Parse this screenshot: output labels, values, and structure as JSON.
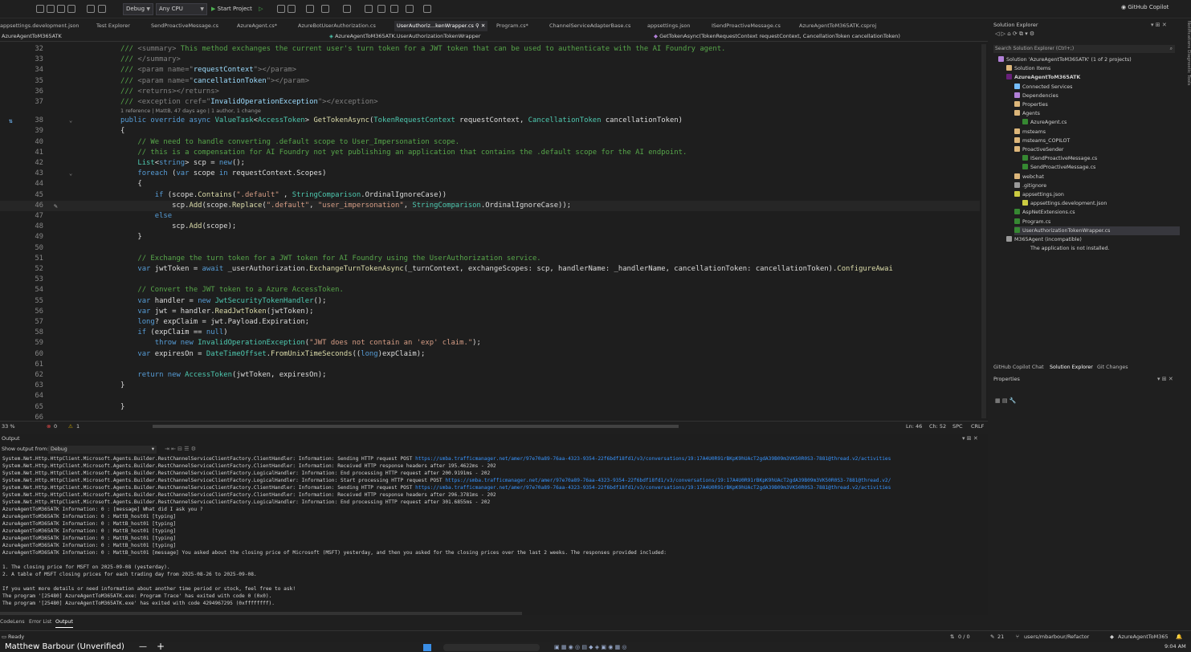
{
  "toolbar": {
    "config": "Debug",
    "platform": "Any CPU",
    "start": "Start Project",
    "copilot": "GitHub Copilot"
  },
  "tabs": [
    {
      "label": "appsettings.development.json",
      "active": false
    },
    {
      "label": "Test Explorer",
      "active": false
    },
    {
      "label": "SendProactiveMessage.cs",
      "active": false
    },
    {
      "label": "AzureAgent.cs*",
      "active": false
    },
    {
      "label": "AzureBotUserAuthorization.cs",
      "active": false
    },
    {
      "label": "UserAuthoriz...kenWrapper.cs",
      "active": true
    },
    {
      "label": "Program.cs*",
      "active": false
    },
    {
      "label": "ChannelServiceAdapterBase.cs",
      "active": false
    },
    {
      "label": "appsettings.json",
      "active": false
    },
    {
      "label": "ISendProactiveMessage.cs",
      "active": false
    },
    {
      "label": "AzureAgentToM365ATK.csproj",
      "active": false
    }
  ],
  "nav": {
    "project": "AzureAgentToM365ATK",
    "type": "AzureAgentToM365ATK.UserAuthorizationTokenWrapper",
    "member": "GetTokenAsync(TokenRequestContext requestContext, CancellationToken cancellationToken)"
  },
  "code": [
    {
      "n": "32",
      "t": [
        [
          "/// ",
          "cm"
        ],
        [
          "<summary>",
          "xm"
        ],
        [
          " This method exchanges the current user's turn token for a JWT token that can be used to authenticate with the AI Foundry agent.",
          "cm"
        ]
      ]
    },
    {
      "n": "33",
      "t": [
        [
          "/// ",
          "cm"
        ],
        [
          "</summary>",
          "xm"
        ]
      ]
    },
    {
      "n": "34",
      "t": [
        [
          "/// ",
          "cm"
        ],
        [
          "<param name=\"",
          "xm"
        ],
        [
          "requestContext",
          "pm"
        ],
        [
          "\"></param>",
          "xm"
        ]
      ]
    },
    {
      "n": "35",
      "t": [
        [
          "/// ",
          "cm"
        ],
        [
          "<param name=\"",
          "xm"
        ],
        [
          "cancellationToken",
          "pm"
        ],
        [
          "\"></param>",
          "xm"
        ]
      ]
    },
    {
      "n": "36",
      "t": [
        [
          "/// ",
          "cm"
        ],
        [
          "<returns></returns>",
          "xm"
        ]
      ]
    },
    {
      "n": "37",
      "t": [
        [
          "/// ",
          "cm"
        ],
        [
          "<exception cref=\"",
          "xm"
        ],
        [
          "InvalidOperationException",
          "pm"
        ],
        [
          "\"></exception>",
          "xm"
        ]
      ],
      "lens": "1 reference | MattB, 47 days ago | 1 author, 1 change"
    },
    {
      "n": "38",
      "t": [
        [
          "public override async ",
          "kw"
        ],
        [
          "ValueTask",
          "ty"
        ],
        [
          "<",
          ""
        ],
        [
          "AccessToken",
          "ty"
        ],
        [
          "> ",
          ""
        ],
        [
          "GetTokenAsync",
          "mt"
        ],
        [
          "(",
          ""
        ],
        [
          "TokenRequestContext",
          "ty"
        ],
        [
          " requestContext, ",
          ""
        ],
        [
          "CancellationToken",
          "ty"
        ],
        [
          " cancellationToken)",
          ""
        ]
      ]
    },
    {
      "n": "39",
      "t": [
        [
          "{",
          ""
        ]
      ]
    },
    {
      "n": "40",
      "t": [
        [
          "    // We need to handle converting .default scope to User_Impersonation scope.",
          "cm"
        ]
      ]
    },
    {
      "n": "41",
      "t": [
        [
          "    // this is a compensation for AI Foundry not yet publishing an application that contains the .default scope for the AI endpoint.",
          "cm"
        ]
      ]
    },
    {
      "n": "42",
      "t": [
        [
          "    ",
          ""
        ],
        [
          "List",
          "ty"
        ],
        [
          "<",
          ""
        ],
        [
          "string",
          "kw"
        ],
        [
          "> scp = ",
          ""
        ],
        [
          "new",
          "kw"
        ],
        [
          "();",
          ""
        ]
      ]
    },
    {
      "n": "43",
      "t": [
        [
          "    ",
          ""
        ],
        [
          "foreach",
          "kw"
        ],
        [
          " (",
          ""
        ],
        [
          "var",
          "kw"
        ],
        [
          " scope ",
          ""
        ],
        [
          "in",
          "kw"
        ],
        [
          " requestContext.Scopes)",
          ""
        ]
      ]
    },
    {
      "n": "44",
      "t": [
        [
          "    {",
          ""
        ]
      ]
    },
    {
      "n": "45",
      "t": [
        [
          "        ",
          ""
        ],
        [
          "if",
          "kw"
        ],
        [
          " (scope.",
          ""
        ],
        [
          "Contains",
          "mt"
        ],
        [
          "(",
          ""
        ],
        [
          "\".default\"",
          "st"
        ],
        [
          " , ",
          ""
        ],
        [
          "StringComparison",
          "ty"
        ],
        [
          ".OrdinalIgnoreCase))",
          ""
        ]
      ]
    },
    {
      "n": "46",
      "t": [
        [
          "            scp.",
          ""
        ],
        [
          "Add",
          "mt"
        ],
        [
          "(scope.",
          ""
        ],
        [
          "Replace",
          "mt"
        ],
        [
          "(",
          ""
        ],
        [
          "\".default\"",
          "st"
        ],
        [
          ", ",
          ""
        ],
        [
          "\"user_impersonation\"",
          "st"
        ],
        [
          ", ",
          ""
        ],
        [
          "StringComparison",
          "ty"
        ],
        [
          ".OrdinalIgnoreCase));",
          ""
        ]
      ]
    },
    {
      "n": "47",
      "t": [
        [
          "        ",
          ""
        ],
        [
          "else",
          "kw"
        ]
      ]
    },
    {
      "n": "48",
      "t": [
        [
          "            scp.",
          ""
        ],
        [
          "Add",
          "mt"
        ],
        [
          "(scope);",
          ""
        ]
      ]
    },
    {
      "n": "49",
      "t": [
        [
          "    }",
          ""
        ]
      ]
    },
    {
      "n": "50",
      "t": [
        [
          "",
          ""
        ]
      ]
    },
    {
      "n": "51",
      "t": [
        [
          "    // Exchange the turn token for a JWT token for AI Foundry using the UserAuthorization service.",
          "cm"
        ]
      ]
    },
    {
      "n": "52",
      "t": [
        [
          "    ",
          ""
        ],
        [
          "var",
          "kw"
        ],
        [
          " jwtToken = ",
          ""
        ],
        [
          "await",
          "kw"
        ],
        [
          " _userAuthorization.",
          ""
        ],
        [
          "ExchangeTurnTokenAsync",
          "mt"
        ],
        [
          "(_turnContext, exchangeScopes: scp, handlerName: _handlerName, cancellationToken: cancellationToken).",
          ""
        ],
        [
          "ConfigureAwai",
          "mt"
        ]
      ]
    },
    {
      "n": "53",
      "t": [
        [
          "",
          ""
        ]
      ]
    },
    {
      "n": "54",
      "t": [
        [
          "    // Convert the JWT token to a Azure AccessToken.",
          "cm"
        ]
      ]
    },
    {
      "n": "55",
      "t": [
        [
          "    ",
          ""
        ],
        [
          "var",
          "kw"
        ],
        [
          " handler = ",
          ""
        ],
        [
          "new",
          "kw"
        ],
        [
          " ",
          ""
        ],
        [
          "JwtSecurityTokenHandler",
          "ty"
        ],
        [
          "();",
          ""
        ]
      ]
    },
    {
      "n": "56",
      "t": [
        [
          "    ",
          ""
        ],
        [
          "var",
          "kw"
        ],
        [
          " jwt = handler.",
          ""
        ],
        [
          "ReadJwtToken",
          "mt"
        ],
        [
          "(jwtToken);",
          ""
        ]
      ]
    },
    {
      "n": "57",
      "t": [
        [
          "    ",
          ""
        ],
        [
          "long",
          "kw"
        ],
        [
          "? expClaim = jwt.Payload.Expiration;",
          ""
        ]
      ]
    },
    {
      "n": "58",
      "t": [
        [
          "    ",
          ""
        ],
        [
          "if",
          "kw"
        ],
        [
          " (expClaim == ",
          ""
        ],
        [
          "null",
          "kw"
        ],
        [
          ")",
          ""
        ]
      ]
    },
    {
      "n": "59",
      "t": [
        [
          "        ",
          ""
        ],
        [
          "throw new ",
          "kw"
        ],
        [
          "InvalidOperationException",
          "ty"
        ],
        [
          "(",
          ""
        ],
        [
          "\"JWT does not contain an 'exp' claim.\"",
          "st"
        ],
        [
          ");",
          ""
        ]
      ]
    },
    {
      "n": "60",
      "t": [
        [
          "    ",
          ""
        ],
        [
          "var",
          "kw"
        ],
        [
          " expiresOn = ",
          ""
        ],
        [
          "DateTimeOffset",
          "ty"
        ],
        [
          ".",
          ""
        ],
        [
          "FromUnixTimeSeconds",
          "mt"
        ],
        [
          "((",
          ""
        ],
        [
          "long",
          "kw"
        ],
        [
          ")expClaim);",
          ""
        ]
      ]
    },
    {
      "n": "61",
      "t": [
        [
          "",
          ""
        ]
      ]
    },
    {
      "n": "62",
      "t": [
        [
          "    ",
          ""
        ],
        [
          "return new ",
          "kw"
        ],
        [
          "AccessToken",
          "ty"
        ],
        [
          "(jwtToken, expiresOn);",
          ""
        ]
      ]
    },
    {
      "n": "63",
      "t": [
        [
          "}",
          ""
        ]
      ]
    },
    {
      "n": "64",
      "t": [
        [
          "",
          ""
        ]
      ]
    },
    {
      "n": "65",
      "t": [
        [
          "}",
          ""
        ]
      ]
    },
    {
      "n": "66",
      "t": [
        [
          "",
          ""
        ]
      ]
    }
  ],
  "editor_status": {
    "zoom": "33 %",
    "errors": "0",
    "warnings": "1",
    "ln": "Ln: 46",
    "ch": "Ch: 52",
    "spc": "SPC",
    "crlf": "CRLF"
  },
  "solution": {
    "title": "Solution Explorer",
    "search": "Search Solution Explorer (Ctrl+;)",
    "items": [
      {
        "label": "Solution 'AzureAgentToM365ATK' (1 of 2 projects)",
        "indent": 0,
        "color": "#b180d7"
      },
      {
        "label": "Solution Items",
        "indent": 1,
        "color": "#dcb67a"
      },
      {
        "label": "AzureAgentToM365ATK",
        "indent": 1,
        "color": "#68217a",
        "bold": true
      },
      {
        "label": "Connected Services",
        "indent": 2,
        "color": "#75beff"
      },
      {
        "label": "Dependencies",
        "indent": 2,
        "color": "#b180d7"
      },
      {
        "label": "Properties",
        "indent": 2,
        "color": "#dcb67a"
      },
      {
        "label": "Agents",
        "indent": 2,
        "color": "#dcb67a"
      },
      {
        "label": "AzureAgent.cs",
        "indent": 3,
        "color": "#368832"
      },
      {
        "label": "msteams",
        "indent": 2,
        "color": "#dcb67a"
      },
      {
        "label": "msteams_COPILOT",
        "indent": 2,
        "color": "#dcb67a"
      },
      {
        "label": "ProactiveSender",
        "indent": 2,
        "color": "#dcb67a"
      },
      {
        "label": "ISendProactiveMessage.cs",
        "indent": 3,
        "color": "#368832"
      },
      {
        "label": "SendProactiveMessage.cs",
        "indent": 3,
        "color": "#368832"
      },
      {
        "label": "webchat",
        "indent": 2,
        "color": "#dcb67a"
      },
      {
        "label": ".gitignore",
        "indent": 2,
        "color": "#999999"
      },
      {
        "label": "appsettings.json",
        "indent": 2,
        "color": "#cbcb41"
      },
      {
        "label": "appsettings.development.json",
        "indent": 3,
        "color": "#cbcb41"
      },
      {
        "label": "AspNetExtensions.cs",
        "indent": 2,
        "color": "#368832"
      },
      {
        "label": "Program.cs",
        "indent": 2,
        "color": "#368832"
      },
      {
        "label": "UserAuthorizationTokenWrapper.cs",
        "indent": 2,
        "color": "#368832",
        "selected": true
      },
      {
        "label": "M365Agent (incompatible)",
        "indent": 1,
        "color": "#999999"
      },
      {
        "label": "The application is not installed.",
        "indent": 3,
        "color": "#1f1f1f"
      }
    ],
    "bottom_tabs": [
      "GitHub Copilot Chat",
      "Solution Explorer",
      "Git Changes"
    ],
    "properties": "Properties"
  },
  "output": {
    "title": "Output",
    "show_from": "Show output from:",
    "source": "Debug",
    "lines": [
      {
        "t": "System.Net.Http.HttpClient.Microsoft.Agents.Builder.RestChannelServiceClientFactory.ClientHandler: Information: Sending HTTP request POST ",
        "u": "https://smba.trafficmanager.net/amer/97e70a89-76aa-4323-9354-22f6bdf18fd1/v3/conversations/19:17A4U0R91rBKpK9hUAcT2gdA39B09m3VK50R0S3-7881@thread.v2/activities"
      },
      {
        "t": "System.Net.Http.HttpClient.Microsoft.Agents.Builder.RestChannelServiceClientFactory.ClientHandler: Information: Received HTTP response headers after 195.4622ms - 202"
      },
      {
        "t": "System.Net.Http.HttpClient.Microsoft.Agents.Builder.RestChannelServiceClientFactory.LogicalHandler: Information: End processing HTTP request after 200.9191ms - 202"
      },
      {
        "t": "System.Net.Http.HttpClient.Microsoft.Agents.Builder.RestChannelServiceClientFactory.LogicalHandler: Information: Start processing HTTP request POST ",
        "u": "https://smba.trafficmanager.net/amer/97e70a89-76aa-4323-9354-22f6bdf18fd1/v3/conversations/19:17A4U0R91rBKpK9hUAcT2gdA39B09m3VK50R0S3-7881@thread.v2/"
      },
      {
        "t": "System.Net.Http.HttpClient.Microsoft.Agents.Builder.RestChannelServiceClientFactory.ClientHandler: Information: Sending HTTP request POST ",
        "u": "https://smba.trafficmanager.net/amer/97e70a89-76aa-4323-9354-22f6bdf18fd1/v3/conversations/19:17A4U0R91rBKpK9hUAcT2gdA39B09m3VK50R0S3-7881@thread.v2/activities"
      },
      {
        "t": "System.Net.Http.HttpClient.Microsoft.Agents.Builder.RestChannelServiceClientFactory.ClientHandler: Information: Received HTTP response headers after 296.3781ms - 202"
      },
      {
        "t": "System.Net.Http.HttpClient.Microsoft.Agents.Builder.RestChannelServiceClientFactory.LogicalHandler: Information: End processing HTTP request after 301.6855ms - 202"
      },
      {
        "t": "AzureAgentToM365ATK Information: 0 : [message] What did I ask you ?"
      },
      {
        "t": "AzureAgentToM365ATK Information: 0 : MattB_host01 [typing]"
      },
      {
        "t": "AzureAgentToM365ATK Information: 0 : MattB_host01 [typing]"
      },
      {
        "t": "AzureAgentToM365ATK Information: 0 : MattB_host01 [typing]"
      },
      {
        "t": "AzureAgentToM365ATK Information: 0 : MattB_host01 [typing]"
      },
      {
        "t": "AzureAgentToM365ATK Information: 0 : MattB_host01 [typing]"
      },
      {
        "t": "AzureAgentToM365ATK Information: 0 : MattB_host01 [message] You asked about the closing price of Microsoft (MSFT) yesterday, and then you asked for the closing prices over the last 2 weeks. The responses provided included:"
      },
      {
        "t": ""
      },
      {
        "t": "1. The closing price for MSFT on 2025-09-08 (yesterday)."
      },
      {
        "t": "2. A table of MSFT closing prices for each trading day from 2025-08-26 to 2025-09-08."
      },
      {
        "t": ""
      },
      {
        "t": "If you want more details or need information about another time period or stock, feel free to ask!"
      },
      {
        "t": "The program '[25480] AzureAgentToM365ATK.exe: Program Trace' has exited with code 0 (0x0)."
      },
      {
        "t": "The program '[25480] AzureAgentToM365ATK.exe' has exited with code 4294967295 (0xffffffff)."
      }
    ],
    "tabs": [
      "CodeLens",
      "Error List",
      "Output"
    ]
  },
  "statusbar": {
    "ready": "Ready",
    "sync": "0 / 0",
    "changes": "21",
    "branch": "users/mbarbour/Refactor",
    "repo": "AzureAgentToM365"
  },
  "taskbar": {
    "user": "Matthew Barbour (Unverified)",
    "time": "9:04 AM"
  }
}
